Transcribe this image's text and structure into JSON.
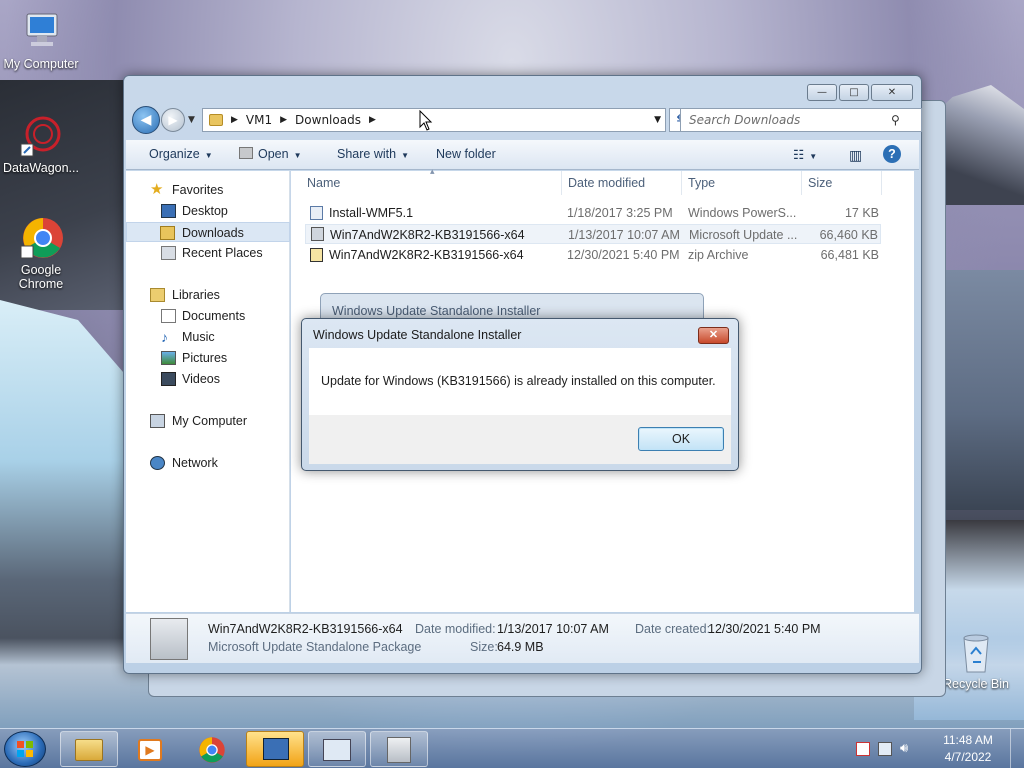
{
  "desktop": {
    "icons": [
      {
        "label": "My Computer",
        "icon": "computer-icon"
      },
      {
        "label": "DataWagon...",
        "icon": "datawagon-icon"
      },
      {
        "label": "Google Chrome",
        "icon": "chrome-icon"
      },
      {
        "label": "Recycle Bin",
        "icon": "recycle-bin-icon"
      }
    ]
  },
  "explorer": {
    "caption_buttons": {
      "minimize": "—",
      "maximize": "□",
      "close": "✕"
    },
    "breadcrumb": [
      "VM1",
      "Downloads"
    ],
    "search_placeholder": "Search Downloads",
    "toolbar": {
      "organize": "Organize",
      "open": "Open",
      "share_with": "Share with",
      "new_folder": "New folder"
    },
    "nav": {
      "favorites": "Favorites",
      "desktop": "Desktop",
      "downloads": "Downloads",
      "recent_places": "Recent Places",
      "libraries": "Libraries",
      "documents": "Documents",
      "music": "Music",
      "pictures": "Pictures",
      "videos": "Videos",
      "my_computer": "My Computer",
      "network": "Network"
    },
    "columns": {
      "name": "Name",
      "date_modified": "Date modified",
      "type": "Type",
      "size": "Size"
    },
    "files": [
      {
        "name": "Install-WMF5.1",
        "date": "1/18/2017 3:25 PM",
        "type": "Windows PowerS...",
        "size": "17 KB"
      },
      {
        "name": "Win7AndW2K8R2-KB3191566-x64",
        "date": "1/13/2017 10:07 AM",
        "type": "Microsoft Update ...",
        "size": "66,460 KB"
      },
      {
        "name": "Win7AndW2K8R2-KB3191566-x64",
        "date": "12/30/2021 5:40 PM",
        "type": "zip Archive",
        "size": "66,481 KB"
      }
    ],
    "details": {
      "name": "Win7AndW2K8R2-KB3191566-x64",
      "type": "Microsoft Update Standalone Package",
      "date_modified_label": "Date modified:",
      "date_modified": "1/13/2017 10:07 AM",
      "date_created_label": "Date created:",
      "date_created": "12/30/2021 5:40 PM",
      "size_label": "Size:",
      "size": "64.9 MB"
    }
  },
  "background_dialog": {
    "title": "Windows Update Standalone Installer"
  },
  "dialog": {
    "title": "Windows Update Standalone Installer",
    "close": "✕",
    "message": "Update for Windows (KB3191566) is already installed on this computer.",
    "ok_label": "OK"
  },
  "taskbar": {
    "time": "11:48 AM",
    "date": "4/7/2022"
  },
  "colors": {
    "accent": "#2c6fb5",
    "selection": "#dbe7f4",
    "close_red": "#c84a2c"
  }
}
